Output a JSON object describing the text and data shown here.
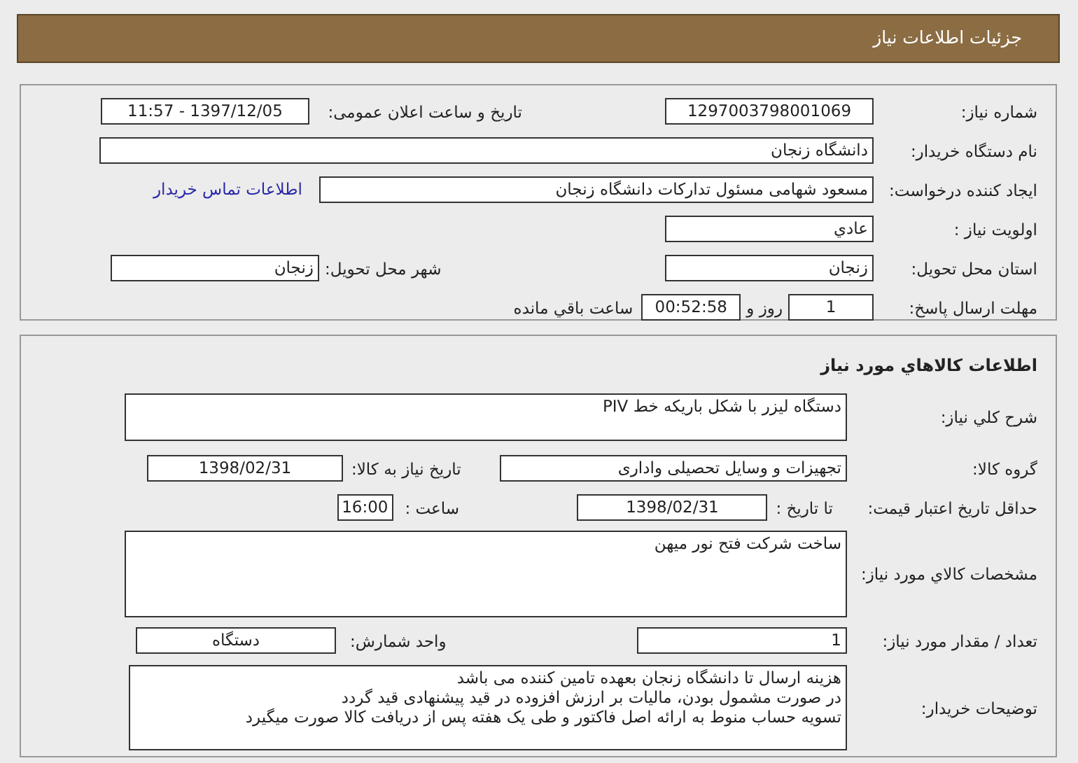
{
  "header": {
    "title": "جزئیات اطلاعات نیاز"
  },
  "need_info": {
    "need_number": {
      "label": "شماره نیاز:",
      "value": "1297003798001069"
    },
    "announce": {
      "label": "تاریخ و ساعت اعلان عمومی:",
      "value": "1397/12/05 - 11:57"
    },
    "buyer": {
      "label": "نام دستگاه خریدار:",
      "value": "دانشگاه زنجان"
    },
    "requester": {
      "label": "ایجاد کننده درخواست:",
      "value": "مسعود شهامی مسئول تدارکات دانشگاه زنجان"
    },
    "contact_link": "اطلاعات تماس خریدار",
    "priority": {
      "label": "اولویت نیاز :",
      "value": "عادي"
    },
    "province": {
      "label": "استان محل تحویل:",
      "value": "زنجان"
    },
    "city": {
      "label": "شهر محل تحویل:",
      "value": "زنجان"
    },
    "deadline": {
      "label": "مهلت ارسال پاسخ:",
      "days": "1",
      "days_unit": "روز و",
      "time": "00:52:58",
      "time_unit": "ساعت باقي مانده"
    }
  },
  "goods_info": {
    "title": "اطلاعات كالاهاي مورد نياز",
    "description": {
      "label": "شرح كلي نياز:",
      "value": "دستگاه لیزر با شکل باریکه خط PIV"
    },
    "group": {
      "label": "گروه كالا:",
      "value": "تجهیزات و وسایل تحصیلی واداری"
    },
    "need_date": {
      "label": "تاريخ نياز به كالا:",
      "value": "1398/02/31"
    },
    "price_validity": {
      "label": "حداقل تاريخ اعتبار قيمت:",
      "date_label": "تا تاريخ :",
      "date": "1398/02/31",
      "time_label": "ساعت :",
      "time": "16:00"
    },
    "specs": {
      "label": "مشخصات كالاي مورد نياز:",
      "value": "ساخت شرکت فتح نور میهن"
    },
    "quantity": {
      "label": "تعداد / مقدار مورد نياز:",
      "value": "1"
    },
    "unit": {
      "label": "واحد شمارش:",
      "value": "دستگاه"
    },
    "notes": {
      "label": "توضيحات خريدار:",
      "lines": [
        "هزینه ارسال تا دانشگاه زنجان بعهده تامین کننده می باشد",
        "در صورت مشمول بودن، مالیات بر ارزش افزوده در قید پیشنهادی قید گردد",
        "تسویه حساب منوط به ارائه اصل فاکتور و طی یک هفته پس از دریافت کالا صورت میگیرد"
      ]
    }
  }
}
